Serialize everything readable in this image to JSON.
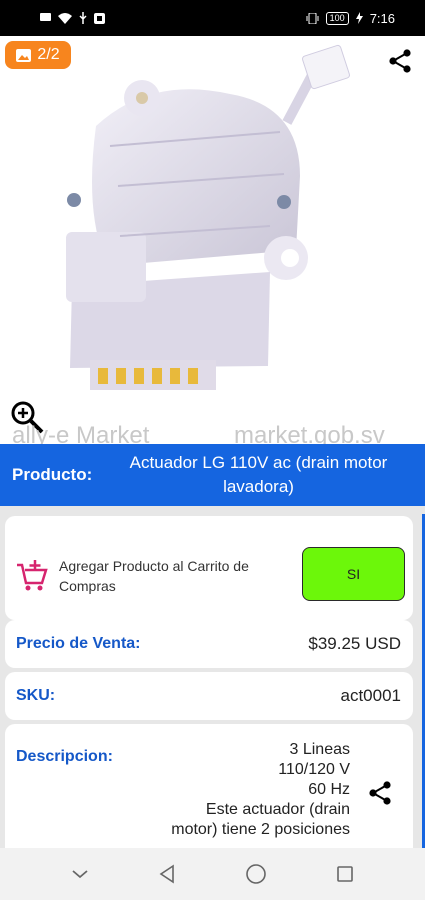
{
  "status_bar": {
    "time": "7:16",
    "battery": "100",
    "left_icons": [
      "message-icon",
      "wifi-icon",
      "usb-icon",
      "notification-icon"
    ],
    "right_icons": [
      "vibrate-icon",
      "battery-icon",
      "charging-icon"
    ]
  },
  "gallery": {
    "counter": "2/2",
    "counter_color": "#f7851e",
    "watermark_left": "ally-e Market",
    "watermark_right": "market.gob.sv"
  },
  "product": {
    "label": "Producto:",
    "name": "Actuador LG 110V ac (drain motor lavadora)",
    "title_bar_color": "#1565e0"
  },
  "cart": {
    "label": "Agregar Producto al Carrito de Compras",
    "button_label": "SI",
    "button_color": "#6cf70a",
    "icon_color": "#d6246e"
  },
  "price": {
    "label": "Precio de Venta:",
    "value": "$39.25 USD"
  },
  "sku": {
    "label": "SKU:",
    "value": "act0001"
  },
  "description": {
    "label": "Descripcion:",
    "lines": [
      "3 Lineas",
      "110/120 V",
      "60 Hz",
      "Este actuador (drain",
      "motor) tiene 2 posiciones"
    ]
  },
  "nav": [
    "down-chevron-icon",
    "back-icon",
    "home-icon",
    "recents-icon"
  ]
}
